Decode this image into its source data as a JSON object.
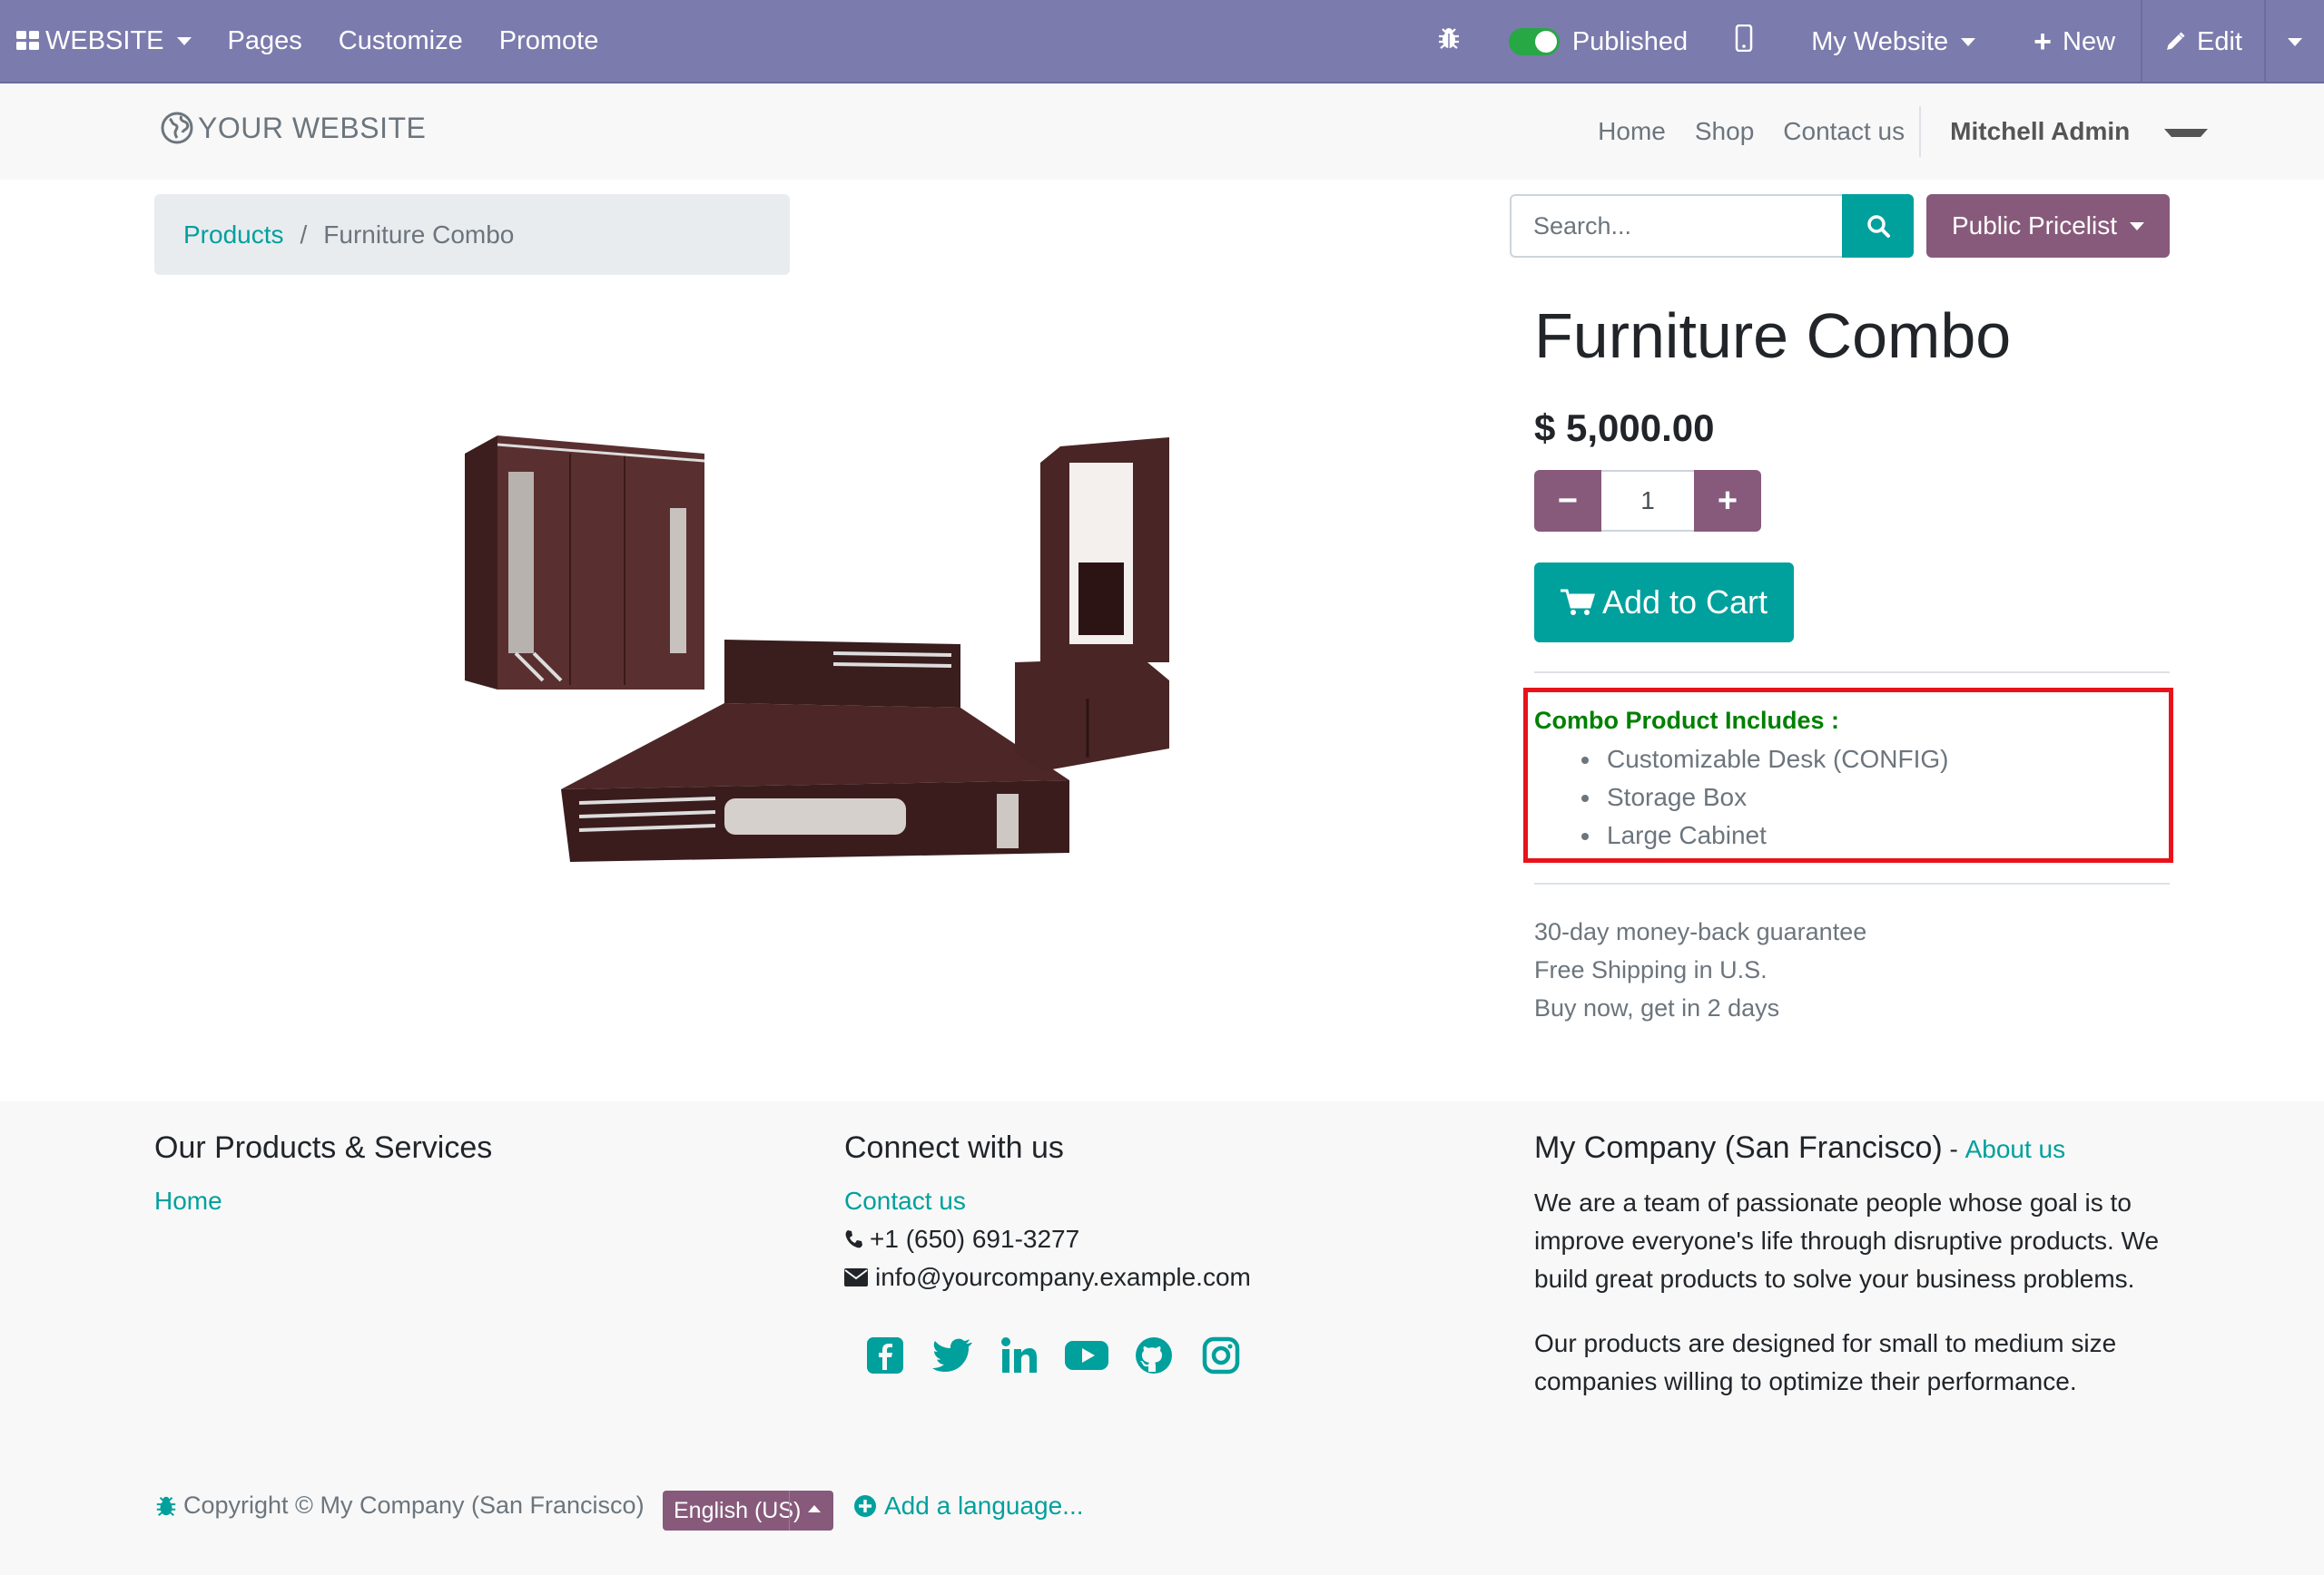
{
  "admin_bar": {
    "app_label": "WEBSITE",
    "menu": [
      "Pages",
      "Customize",
      "Promote"
    ],
    "published_label": "Published",
    "website_label": "My Website",
    "new_label": "New",
    "edit_label": "Edit"
  },
  "navbar": {
    "logo_text": "YOUR WEBSITE",
    "links": [
      "Home",
      "Shop",
      "Contact us"
    ],
    "user": "Mitchell Admin"
  },
  "breadcrumb": {
    "parent": "Products",
    "separator": "/",
    "current": "Furniture Combo"
  },
  "search": {
    "placeholder": "Search..."
  },
  "pricelist_label": "Public Pricelist",
  "product": {
    "title": "Furniture Combo",
    "price": "$ 5,000.00",
    "quantity": "1",
    "add_to_cart_label": "Add to Cart",
    "combo_title": "Combo Product Includes :",
    "combo_items": [
      "Customizable Desk (CONFIG)",
      "Storage Box",
      "Large Cabinet"
    ],
    "guarantees": [
      "30-day money-back guarantee",
      "Free Shipping in U.S.",
      "Buy now, get in 2 days"
    ]
  },
  "footer": {
    "col1": {
      "heading": "Our Products & Services",
      "link": "Home"
    },
    "col2": {
      "heading": "Connect with us",
      "contact_link": "Contact us",
      "phone": "+1 (650) 691-3277",
      "email": "info@yourcompany.example.com"
    },
    "col3": {
      "heading": "My Company (San Francisco)",
      "heading_sep": " - ",
      "about_link": "About us",
      "para1": "We are a team of passionate people whose goal is to improve everyone's life through disruptive products. We build great products to solve your business problems.",
      "para2": "Our products are designed for small to medium size companies willing to optimize their performance."
    },
    "socials": [
      "facebook-icon",
      "twitter-icon",
      "linkedin-icon",
      "youtube-icon",
      "github-icon",
      "instagram-icon"
    ],
    "copyright": "Copyright © My Company (San Francisco)",
    "language": "English (US)",
    "add_language": "Add a language..."
  },
  "colors": {
    "admin_bar": "#7c7bad",
    "accent_teal": "#00a09d",
    "accent_purple": "#875a7b",
    "highlight_red": "#e8131a",
    "combo_green": "#008000"
  }
}
